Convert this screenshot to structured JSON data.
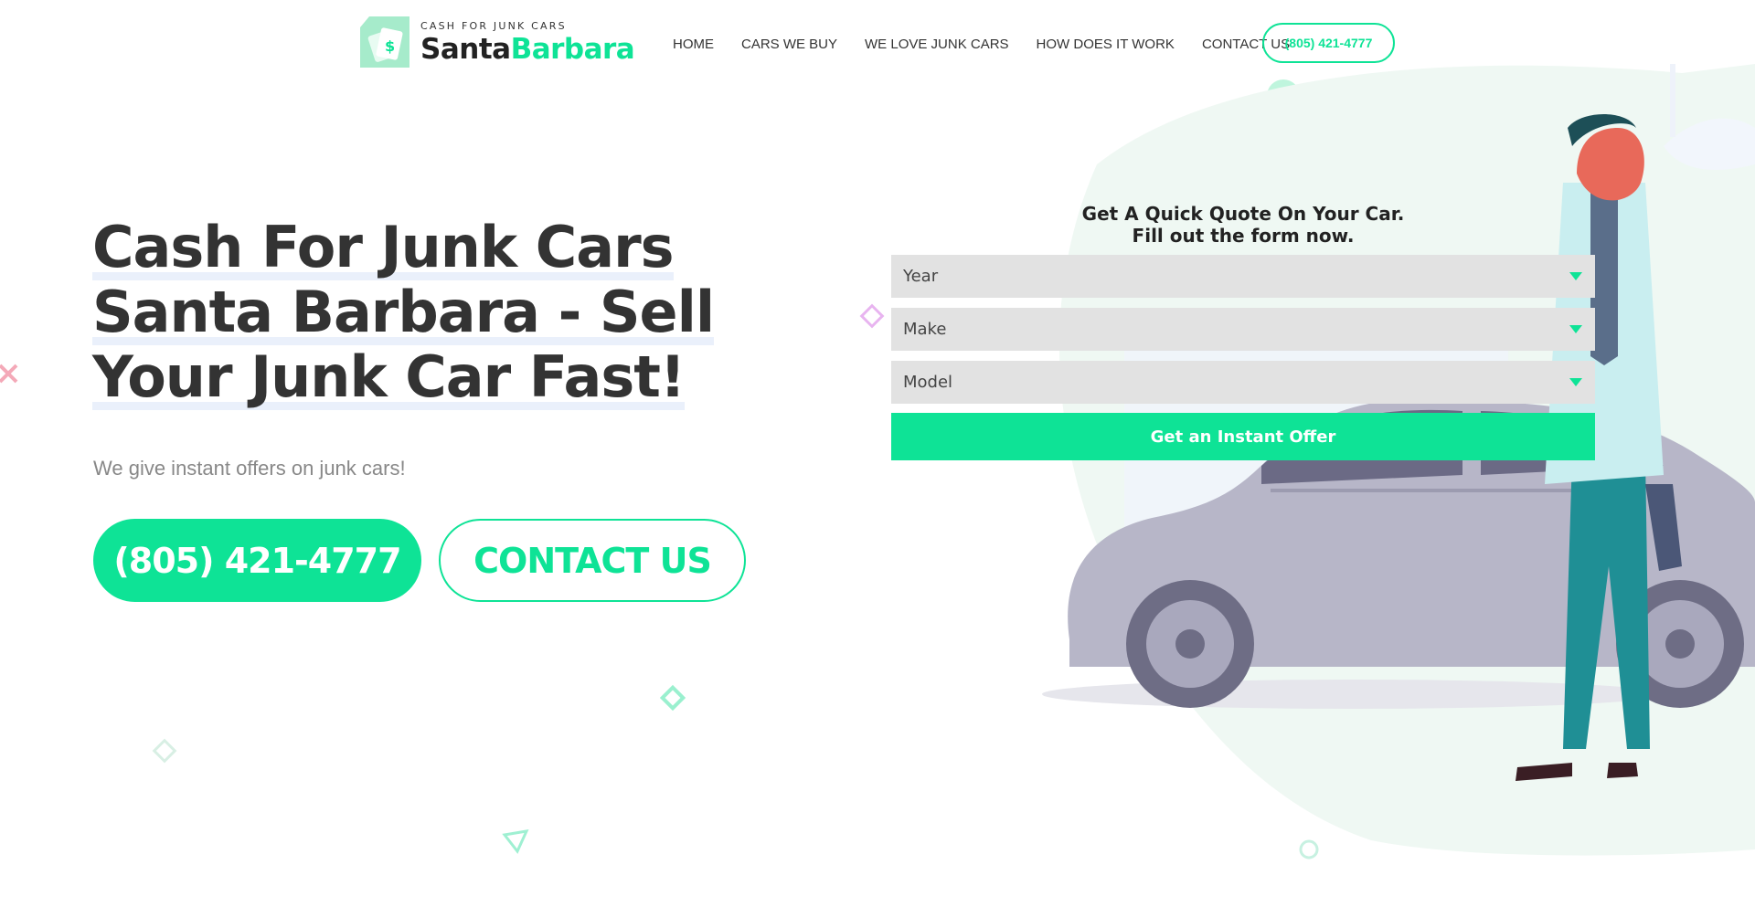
{
  "header": {
    "logo_small": "CASH FOR JUNK CARS",
    "logo_word1": "Santa",
    "logo_word2": "Barbara",
    "nav": [
      "HOME",
      "CARS WE BUY",
      "WE LOVE JUNK CARS",
      "HOW DOES IT WORK",
      "CONTACT US"
    ],
    "phone": "(805) 421-4777"
  },
  "hero": {
    "title": "Cash For Junk Cars Santa Barbara - Sell Your Junk Car Fast!",
    "subtitle": "We give instant offers on junk cars!",
    "phone_button": "(805) 421-4777",
    "contact_button": "CONTACT US"
  },
  "form": {
    "title_line1": "Get A Quick Quote On Your Car.",
    "title_line2": "Fill out the form now.",
    "year": "Year",
    "make": "Make",
    "model": "Model",
    "submit": "Get an Instant Offer"
  },
  "colors": {
    "accent": "#0ee396",
    "text": "#333333",
    "select_bg": "#e2e2e2"
  }
}
